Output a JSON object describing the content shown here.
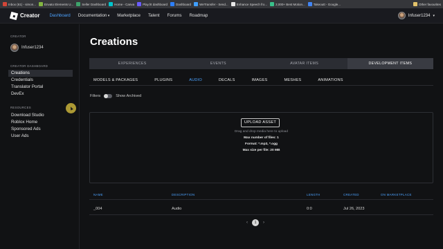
{
  "bookmarks": [
    {
      "label": "Inbox (61) - simon...",
      "color": "#d44638"
    },
    {
      "label": "Envato Elements U...",
      "color": "#82b541"
    },
    {
      "label": "Seller Dashboard",
      "color": "#3ea36b"
    },
    {
      "label": "Home - Canva",
      "color": "#00c4cc"
    },
    {
      "label": "Play.ht dashboard",
      "color": "#6b5cff"
    },
    {
      "label": "Dashboard",
      "color": "#2d7ff9"
    },
    {
      "label": "WeTransfer - Send...",
      "color": "#409fff"
    },
    {
      "label": "Enhance Speech fro...",
      "color": "#e8e8e8"
    },
    {
      "label": "2,000+ Best Motion...",
      "color": "#39c08a"
    },
    {
      "label": "Takeoutt - Google...",
      "color": "#4285f4"
    }
  ],
  "other_bookmarks": "Other favourites",
  "nav": {
    "brand": "Creator",
    "links": [
      "Dashboard",
      "Documentation",
      "Marketplace",
      "Talent",
      "Forums",
      "Roadmap"
    ],
    "active": "Dashboard",
    "username": "Infuser1234"
  },
  "sidebar": {
    "creator_title": "CREATOR",
    "username": "Infuser1234",
    "dashboard_title": "CREATOR DASHBOARD",
    "dashboard_items": [
      "Creations",
      "Credentials",
      "Translator Portal",
      "DevEx"
    ],
    "active_item": "Creations",
    "resources_title": "RESOURCES",
    "resource_items": [
      "Download Studio",
      "Roblox Home",
      "Sponsored Ads",
      "User Ads"
    ]
  },
  "main": {
    "title": "Creations",
    "tabs": [
      "EXPERIENCES",
      "EVENTS",
      "AVATAR ITEMS",
      "DEVELOPMENT ITEMS"
    ],
    "active_tab": "DEVELOPMENT ITEMS",
    "subtabs": [
      "MODELS & PACKAGES",
      "PLUGINS",
      "AUDIO",
      "DECALS",
      "IMAGES",
      "MESHES",
      "ANIMATIONS"
    ],
    "active_subtab": "AUDIO",
    "filters_label": "Filters",
    "show_archived": "Show Archived",
    "show_archived_on": false
  },
  "upload": {
    "button": "UPLOAD ASSET",
    "hint": "Drag and drop media here to upload",
    "max_files": "Max number of files: 1",
    "format": "Format: *.mp3, *.ogg",
    "max_size": "Max size per file: 20 MB"
  },
  "table": {
    "headers": [
      "NAME",
      "DESCRIPTION",
      "LENGTH",
      "CREATED",
      "ON MARKETPLACE"
    ],
    "rows": [
      {
        "name": "_004",
        "description": "Audio",
        "length": "0:0",
        "created": "Jul 26, 2023",
        "on_marketplace": ""
      }
    ]
  },
  "pagination": {
    "prev": "‹",
    "page": "1",
    "next": "›"
  },
  "colors": {
    "accent": "#4da3ff",
    "background": "#111214",
    "nav_bg": "#191a1f"
  }
}
